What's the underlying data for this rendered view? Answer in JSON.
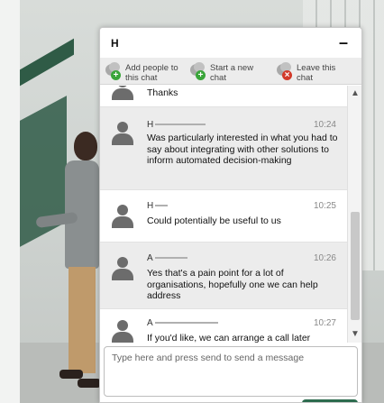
{
  "chat": {
    "title": "H",
    "minimize_symbol": "–",
    "toolbar": [
      {
        "label": "Add people to this chat",
        "icon": "add-people-icon",
        "badge": "+"
      },
      {
        "label": "Start a new chat",
        "icon": "new-chat-icon",
        "badge": "+"
      },
      {
        "label": "Leave this chat",
        "icon": "leave-chat-icon",
        "badge": "×"
      }
    ],
    "messages": [
      {
        "name": "",
        "time": "",
        "text": "Thanks"
      },
      {
        "name": "H",
        "time": "10:24",
        "text": "Was particularly interested in what you had to say about integrating with other solutions to inform automated decision-making"
      },
      {
        "name": "H",
        "time": "10:25",
        "text": "Could potentially be useful to us"
      },
      {
        "name": "A",
        "time": "10:26",
        "text": "Yes that's a pain point for a lot of organisations, hopefully one we can help address"
      },
      {
        "name": "A",
        "time": "10:27",
        "text": "If you'd like, we can arrange a call later"
      }
    ],
    "scroll_up_symbol": "▲",
    "scroll_down_symbol": "▼",
    "composer_placeholder": "Type here and press send to send a message"
  },
  "colors": {
    "accent_green": "#3aa53a",
    "leave_red": "#d23a2a",
    "brand_dark_green": "#2f5b46"
  }
}
